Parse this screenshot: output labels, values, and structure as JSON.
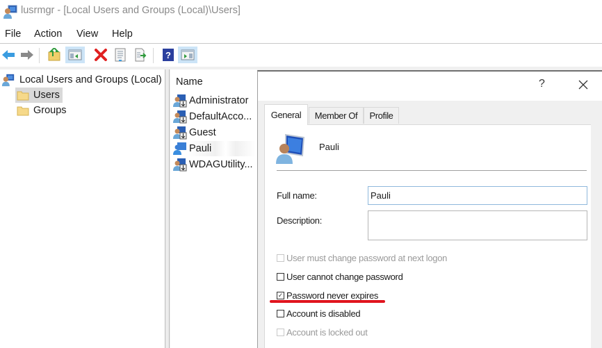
{
  "window": {
    "title": "lusrmgr - [Local Users and Groups (Local)\\Users]",
    "app_icon": "users-computer-icon"
  },
  "menu": {
    "items": [
      {
        "label": "File"
      },
      {
        "label": "Action"
      },
      {
        "label": "View"
      },
      {
        "label": "Help"
      }
    ]
  },
  "toolbar": {
    "buttons": [
      {
        "icon": "back-arrow-icon",
        "tooltip": "Back"
      },
      {
        "icon": "forward-arrow-icon",
        "tooltip": "Forward"
      },
      {
        "icon": "up-folder-icon",
        "tooltip": "Up one level"
      },
      {
        "icon": "show-hide-console-tree-icon",
        "tooltip": "Show/Hide Console Tree",
        "active": true
      },
      {
        "icon": "delete-icon",
        "tooltip": "Delete"
      },
      {
        "icon": "properties-icon",
        "tooltip": "Properties"
      },
      {
        "icon": "export-list-icon",
        "tooltip": "Export List"
      },
      {
        "icon": "help-icon",
        "tooltip": "Help"
      },
      {
        "icon": "show-hide-action-pane-icon",
        "tooltip": "Show/Hide Action Pane",
        "active": true
      }
    ]
  },
  "tree": {
    "root": "Local Users and Groups (Local)",
    "children": [
      {
        "label": "Users",
        "selected": true
      },
      {
        "label": "Groups",
        "selected": false
      }
    ]
  },
  "list": {
    "column_header": "Name",
    "rows": [
      {
        "name": "Administrator",
        "selected": false
      },
      {
        "name": "DefaultAcco...",
        "selected": false
      },
      {
        "name": "Guest",
        "selected": false
      },
      {
        "name": "Pauli",
        "selected": true
      },
      {
        "name": "WDAGUtility...",
        "selected": false
      }
    ]
  },
  "dialog": {
    "help_label": "?",
    "close_icon": "close-icon",
    "tabs": [
      {
        "label": "General",
        "active": true
      },
      {
        "label": "Member Of",
        "active": false
      },
      {
        "label": "Profile",
        "active": false
      }
    ],
    "user_name": "Pauli",
    "fields": {
      "full_name_label": "Full name:",
      "full_name_value": "Pauli",
      "description_label": "Description:",
      "description_value": ""
    },
    "checkboxes": [
      {
        "label": "User must change password at next logon",
        "checked": false,
        "disabled": true
      },
      {
        "label": "User cannot change password",
        "checked": false,
        "disabled": false
      },
      {
        "label": "Password never expires",
        "checked": true,
        "disabled": false,
        "highlighted": true
      },
      {
        "label": "Account is disabled",
        "checked": false,
        "disabled": false
      },
      {
        "label": "Account is locked out",
        "checked": false,
        "disabled": true
      }
    ],
    "highlight_color": "#e0141e"
  }
}
